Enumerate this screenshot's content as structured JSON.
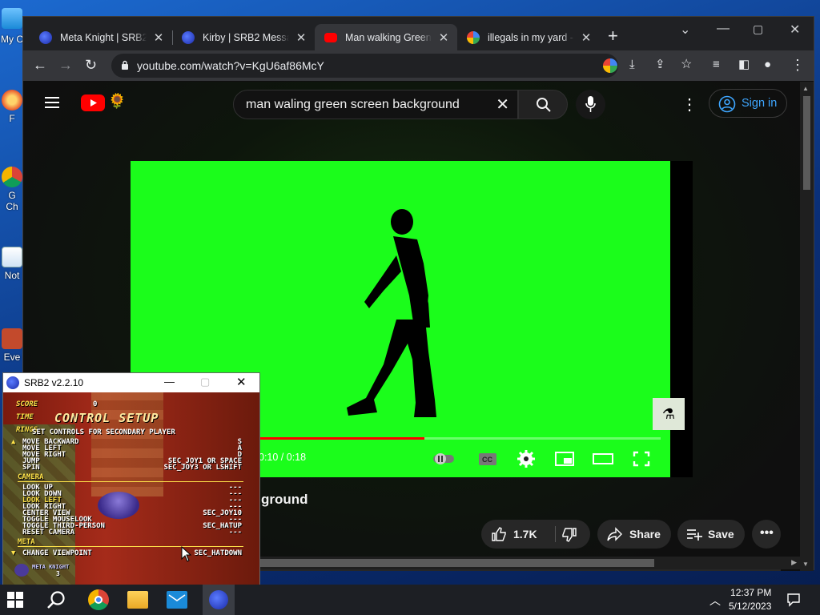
{
  "desktop": {
    "icons": [
      {
        "label": "My C",
        "icon": "this-pc-icon"
      },
      {
        "label": "F",
        "icon": "app-shortcut-icon"
      },
      {
        "label": "G",
        "icon": "chrome-shortcut-icon"
      },
      {
        "label": "Ch",
        "icon": "chrome-shortcut-icon"
      },
      {
        "label": "Not",
        "icon": "notepad-shortcut-icon"
      },
      {
        "label": "Eve",
        "icon": "app-shortcut-icon"
      }
    ]
  },
  "browser": {
    "tabs": [
      {
        "title": "Meta Knight | SRB2 Message Board",
        "favicon": "srb2-favicon",
        "active": false
      },
      {
        "title": "Kirby | SRB2 Message Board",
        "favicon": "srb2-favicon",
        "active": false
      },
      {
        "title": "Man walking Green Screen",
        "favicon": "youtube-favicon",
        "active": true
      },
      {
        "title": "illegals in my yard - Google",
        "favicon": "google-favicon",
        "active": false
      }
    ],
    "url": "youtube.com/watch?v=KgU6af86McY"
  },
  "youtube": {
    "search_query": "man waling green screen background",
    "sign_in_label": "Sign in",
    "video_title_visible": "ground",
    "video_time": "0:10 / 0:18",
    "progress_fraction": 0.555,
    "like_count": "1.7K",
    "share_label": "Share",
    "save_label": "Save",
    "green_color": "#1bfd1b"
  },
  "srb2": {
    "window_title": "SRB2 v2.2.10",
    "hud": {
      "score_label": "SCORE",
      "score_value": "0",
      "time_label": "TIME",
      "rings_label": "RINGS"
    },
    "menu_title": "CONTROL SETUP",
    "subtitle": "SET CONTROLS FOR SECONDARY PLAYER",
    "rows": [
      {
        "label": "MOVE BACKWARD",
        "value": "S"
      },
      {
        "label": "MOVE LEFT",
        "value": "A"
      },
      {
        "label": "MOVE RIGHT",
        "value": "D"
      },
      {
        "label": "JUMP",
        "value": "SEC_JOY1 OR SPACE"
      },
      {
        "label": "SPIN",
        "value": "SEC_JOY3 OR LSHIFT"
      }
    ],
    "camera_header": "CAMERA",
    "camera_rows": [
      {
        "label": "LOOK UP",
        "value": "---"
      },
      {
        "label": "LOOK DOWN",
        "value": "---"
      },
      {
        "label": "LOOK LEFT",
        "value": "---"
      },
      {
        "label": "LOOK RIGHT",
        "value": "---"
      },
      {
        "label": "CENTER VIEW",
        "value": "SEC_JOY10"
      },
      {
        "label": "TOGGLE MOUSELOOK",
        "value": "---"
      },
      {
        "label": "TOGGLE THIRD-PERSON",
        "value": "SEC_HATUP"
      },
      {
        "label": "RESET CAMERA",
        "value": "---"
      }
    ],
    "meta_header": "META",
    "meta_rows": [
      {
        "label": "CHANGE VIEWPOINT",
        "value": "SEC_HATDOWN"
      }
    ],
    "character_name": "META KNIGHT",
    "lives": "3"
  },
  "taskbar": {
    "time": "12:37 PM",
    "date": "5/12/2023"
  }
}
